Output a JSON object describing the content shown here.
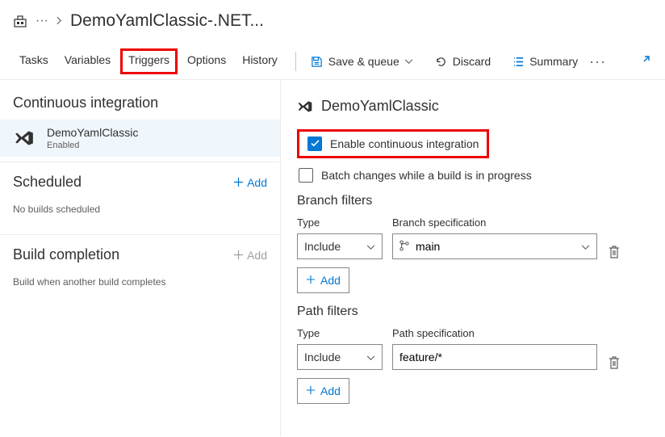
{
  "breadcrumb": {
    "title": "DemoYamlClassic-.NET..."
  },
  "tabs": {
    "tasks": "Tasks",
    "variables": "Variables",
    "triggers": "Triggers",
    "options": "Options",
    "history": "History"
  },
  "toolbar": {
    "save_queue": "Save & queue",
    "discard": "Discard",
    "summary": "Summary"
  },
  "left": {
    "ci": {
      "title": "Continuous integration",
      "repo_name": "DemoYamlClassic",
      "repo_status": "Enabled"
    },
    "scheduled": {
      "title": "Scheduled",
      "add": "Add",
      "note": "No builds scheduled"
    },
    "buildcomp": {
      "title": "Build completion",
      "add": "Add",
      "note": "Build when another build completes"
    }
  },
  "right": {
    "title": "DemoYamlClassic",
    "enable_ci": "Enable continuous integration",
    "batch": "Batch changes while a build is in progress",
    "branch_filters": {
      "title": "Branch filters",
      "type_label": "Type",
      "spec_label": "Branch specification",
      "type_value": "Include",
      "spec_value": "main",
      "add": "Add"
    },
    "path_filters": {
      "title": "Path filters",
      "type_label": "Type",
      "spec_label": "Path specification",
      "type_value": "Include",
      "spec_value": "feature/*",
      "add": "Add"
    }
  }
}
